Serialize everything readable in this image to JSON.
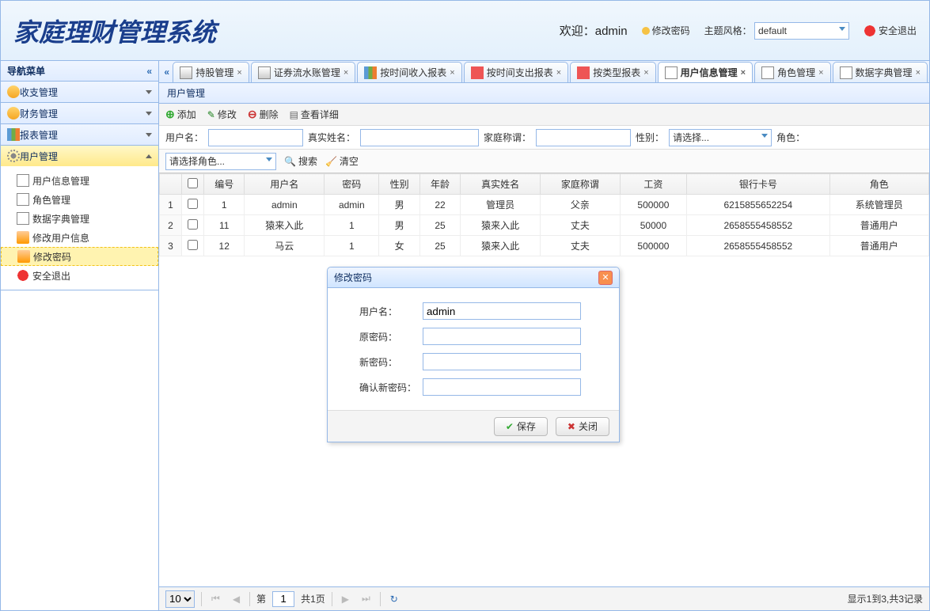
{
  "app_title": "家庭理财管理系统",
  "header": {
    "welcome_prefix": "欢迎：",
    "welcome_user": "admin",
    "change_pwd": "修改密码",
    "theme_label": "主题风格：",
    "theme_value": "default",
    "logout": "安全退出"
  },
  "sidebar": {
    "title": "导航菜单",
    "groups": [
      {
        "label": "收支管理"
      },
      {
        "label": "财务管理"
      },
      {
        "label": "报表管理"
      },
      {
        "label": "用户管理"
      }
    ],
    "user_items": [
      {
        "label": "用户信息管理"
      },
      {
        "label": "角色管理"
      },
      {
        "label": "数据字典管理"
      },
      {
        "label": "修改用户信息"
      },
      {
        "label": "修改密码"
      },
      {
        "label": "安全退出"
      }
    ]
  },
  "tabs": [
    {
      "label": "持股管理"
    },
    {
      "label": "证券流水账管理"
    },
    {
      "label": "按时间收入报表"
    },
    {
      "label": "按时间支出报表"
    },
    {
      "label": "按类型报表"
    },
    {
      "label": "用户信息管理",
      "active": true
    },
    {
      "label": "角色管理"
    },
    {
      "label": "数据字典管理"
    }
  ],
  "panel_title": "用户管理",
  "toolbar": {
    "add": "添加",
    "edit": "修改",
    "delete": "删除",
    "view": "查看详细"
  },
  "search": {
    "username": "用户名：",
    "realname": "真实姓名：",
    "family": "家庭称谓：",
    "gender": "性别：",
    "gender_placeholder": "请选择...",
    "role": "角色：",
    "role_placeholder": "请选择角色...",
    "search_btn": "搜索",
    "clear_btn": "清空"
  },
  "columns": [
    "编号",
    "用户名",
    "密码",
    "性别",
    "年龄",
    "真实姓名",
    "家庭称谓",
    "工资",
    "银行卡号",
    "角色"
  ],
  "rows": [
    {
      "n": 1,
      "id": "1",
      "user": "admin",
      "pwd": "admin",
      "sex": "男",
      "age": "22",
      "real": "管理员",
      "fam": "父亲",
      "sal": "500000",
      "card": "6215855652254",
      "role": "系统管理员"
    },
    {
      "n": 2,
      "id": "11",
      "user": "猿来入此",
      "pwd": "1",
      "sex": "男",
      "age": "25",
      "real": "猿来入此",
      "fam": "丈夫",
      "sal": "50000",
      "card": "2658555458552",
      "role": "普通用户"
    },
    {
      "n": 3,
      "id": "12",
      "user": "马云",
      "pwd": "1",
      "sex": "女",
      "age": "25",
      "real": "猿来入此",
      "fam": "丈夫",
      "sal": "500000",
      "card": "2658555458552",
      "role": "普通用户"
    }
  ],
  "pager": {
    "page_size": "10",
    "page_label": "第",
    "page_value": "1",
    "total_label": "共1页",
    "info": "显示1到3,共3记录"
  },
  "dialog": {
    "title": "修改密码",
    "username_label": "用户名：",
    "username_value": "admin",
    "old_pwd": "原密码：",
    "new_pwd": "新密码：",
    "confirm_pwd": "确认新密码：",
    "save": "保存",
    "close": "关闭"
  }
}
